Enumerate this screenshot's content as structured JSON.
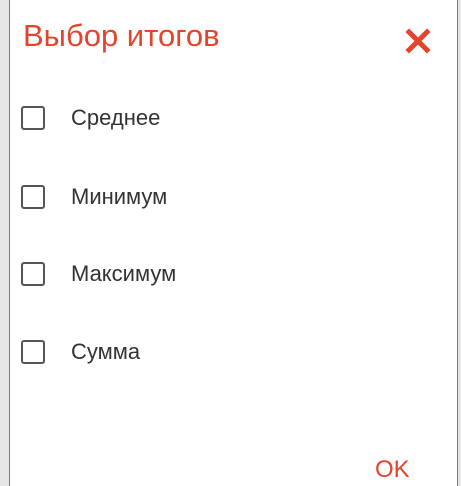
{
  "dialog": {
    "title": "Выбор итогов",
    "close_icon": "close-icon",
    "ok_label": "OK",
    "accent_color": "#e5432b"
  },
  "options": [
    {
      "label": "Среднее",
      "checked": false
    },
    {
      "label": "Минимум",
      "checked": false
    },
    {
      "label": "Максимум",
      "checked": false
    },
    {
      "label": "Сумма",
      "checked": false
    }
  ]
}
